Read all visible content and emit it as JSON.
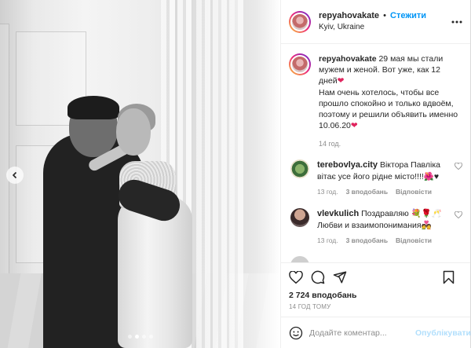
{
  "post": {
    "author": {
      "username": "repyahovakate",
      "follow_label": "Стежити",
      "separator": "•",
      "location": "Kyiv, Ukraine"
    },
    "caption": {
      "username": "repyahovakate",
      "line1": "29 мая мы стали мужем и женой. Вот уже, как 12 дней",
      "line2": "Нам очень хотелось, чтобы все прошло спокойно и только вдвоём, поэтому и решили объявить именно 10.06.20",
      "time": "14 год."
    },
    "comments": [
      {
        "username": "terebovlya.city",
        "text": "Віктора Павліка вітає усе його рідне місто!!!!🌺♥",
        "time": "13 год.",
        "likes": "3 вподобань",
        "reply": "Відповісти"
      },
      {
        "username": "vlevkulich",
        "text": "Поздравляю 💐🌹🥂 Любви и взаимопонимания💑",
        "time": "13 год.",
        "likes": "3 вподобань",
        "reply": "Відповісти"
      }
    ],
    "likes_count": "2 724 вподобань",
    "timestamp": "14 ГОД ТОМУ",
    "comment_input": {
      "placeholder": "Додайте коментар...",
      "publish_label": "Опублікувати"
    },
    "carousel": {
      "slide_count": 4,
      "active_index": 1
    }
  },
  "colors": {
    "accent": "#0095f6",
    "heart": "#e0245e",
    "muted": "#8e8e8e",
    "publish_disabled": "#b2dffc"
  },
  "icons": [
    "more-icon",
    "chevron-left-icon",
    "heart-icon",
    "comment-icon",
    "share-icon",
    "bookmark-icon",
    "emoji-icon",
    "red-heart-icon"
  ]
}
